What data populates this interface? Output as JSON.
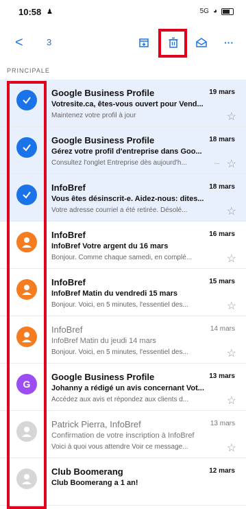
{
  "status_bar": {
    "time": "10:58",
    "right": "5G"
  },
  "toolbar": {
    "back": "<",
    "count": "3"
  },
  "section": "PRINCIPALE",
  "emails": [
    {
      "sender": "Google Business Profile",
      "date": "19 mars",
      "subject": "Votresite.ca, êtes-vous ouvert pour Vend...",
      "snippet": "Maintenez votre profil à jour",
      "selected": true,
      "avatar": "check",
      "unread": true
    },
    {
      "sender": "Google Business Profile",
      "date": "18 mars",
      "subject": "Gérez votre profil d'entreprise dans Goo...",
      "snippet": "Consultez l'onglet Entreprise dès aujourd'h...",
      "selected": true,
      "avatar": "check",
      "unread": true
    },
    {
      "sender": "InfoBref",
      "date": "18 mars",
      "subject": "Vous êtes désinscrit-e. Aidez-nous: dites...",
      "snippet": "Votre adresse courriel a été retirée. Désolé...",
      "selected": true,
      "avatar": "check",
      "unread": true
    },
    {
      "sender": "InfoBref",
      "date": "16 mars",
      "subject": "InfoBref Votre argent du 16 mars",
      "snippet": "Bonjour. Comme chaque samedi, en complé...",
      "selected": false,
      "avatar": "person-orange",
      "unread": true
    },
    {
      "sender": "InfoBref",
      "date": "15 mars",
      "subject": "InfoBref Matin du vendredi 15 mars",
      "snippet": "Bonjour. Voici, en 5 minutes, l'essentiel des...",
      "selected": false,
      "avatar": "person-orange",
      "unread": true
    },
    {
      "sender": "InfoBref",
      "date": "14 mars",
      "subject": "InfoBref Matin du jeudi 14 mars",
      "snippet": "Bonjour. Voici, en 5 minutes, l'essentiel des...",
      "selected": false,
      "avatar": "person-orange",
      "unread": false
    },
    {
      "sender": "Google Business Profile",
      "date": "13 mars",
      "subject": "Johanny a rédigé un avis concernant Vot...",
      "snippet": "Accédez aux avis et répondez aux clients d...",
      "selected": false,
      "avatar": "G",
      "unread": true
    },
    {
      "sender": "Patrick Pierra, InfoBref",
      "date": "13 mars",
      "subject": "Confirmation de votre inscription à InfoBref",
      "snippet": "Voici à quoi vous attendre Voir ce message...",
      "selected": false,
      "avatar": "person-gray",
      "unread": false
    },
    {
      "sender": "Club Boomerang",
      "date": "12 mars",
      "subject": "Club Boomerang a 1 an!",
      "snippet": "",
      "selected": false,
      "avatar": "person-gray",
      "unread": true
    }
  ],
  "colors": {
    "accent": "#1a73e8",
    "selected_bg": "#e8f0fe",
    "highlight": "#e0001b",
    "avatar_orange": "#f57c1f",
    "avatar_purple": "#9c4df4",
    "avatar_gray": "#d6d6d6"
  }
}
